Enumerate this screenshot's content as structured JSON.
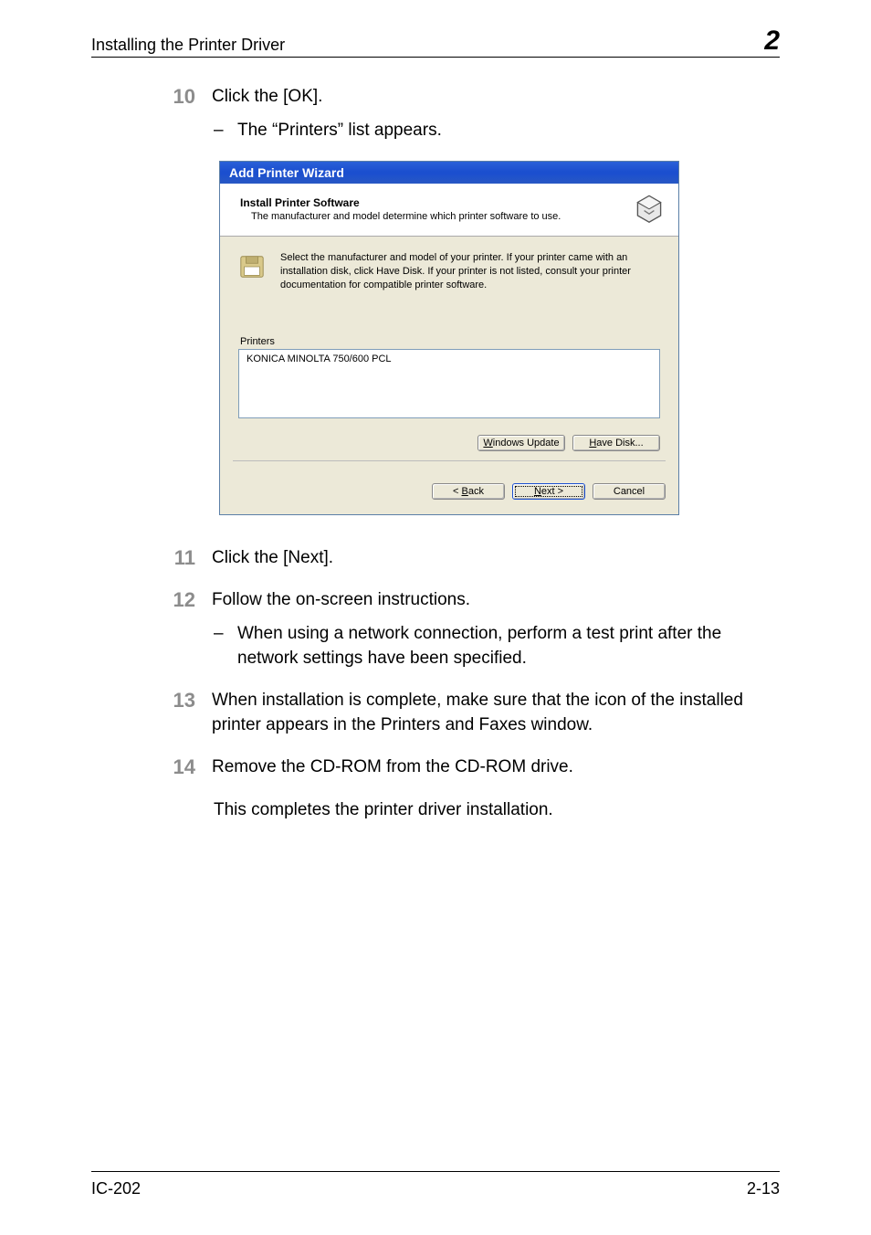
{
  "header": {
    "section_title": "Installing the Printer Driver",
    "chapter_number": "2"
  },
  "steps": {
    "s10": {
      "num": "10",
      "text": "Click the [OK].",
      "sub": "The “Printers” list appears."
    },
    "s11": {
      "num": "11",
      "text": "Click the [Next]."
    },
    "s12": {
      "num": "12",
      "text": "Follow the on-screen instructions.",
      "sub": "When using a network connection, perform a test print after the network settings have been specified."
    },
    "s13": {
      "num": "13",
      "text": "When installation is complete, make sure that the icon of the installed printer appears in the Printers and Faxes window."
    },
    "s14": {
      "num": "14",
      "text": "Remove the CD-ROM from the CD-ROM drive."
    }
  },
  "closing": "This completes the printer driver installation.",
  "dialog": {
    "title": "Add Printer Wizard",
    "head_title": "Install Printer Software",
    "head_sub": "The manufacturer and model determine which printer software to use.",
    "instruction": "Select the manufacturer and model of your printer. If your printer came with an installation disk, click Have Disk. If your printer is not listed, consult your printer documentation for compatible printer software.",
    "list_label": "Printers",
    "list_item": "KONICA MINOLTA 750/600 PCL",
    "btn_windows_update_pre": "W",
    "btn_windows_update_post": "indows Update",
    "btn_have_disk_pre": "H",
    "btn_have_disk_post": "ave Disk...",
    "btn_back_pre": "< ",
    "btn_back_u": "B",
    "btn_back_post": "ack",
    "btn_next_pre": "N",
    "btn_next_post": "ext >",
    "btn_cancel": "Cancel"
  },
  "footer": {
    "left": "IC-202",
    "right": "2-13"
  }
}
